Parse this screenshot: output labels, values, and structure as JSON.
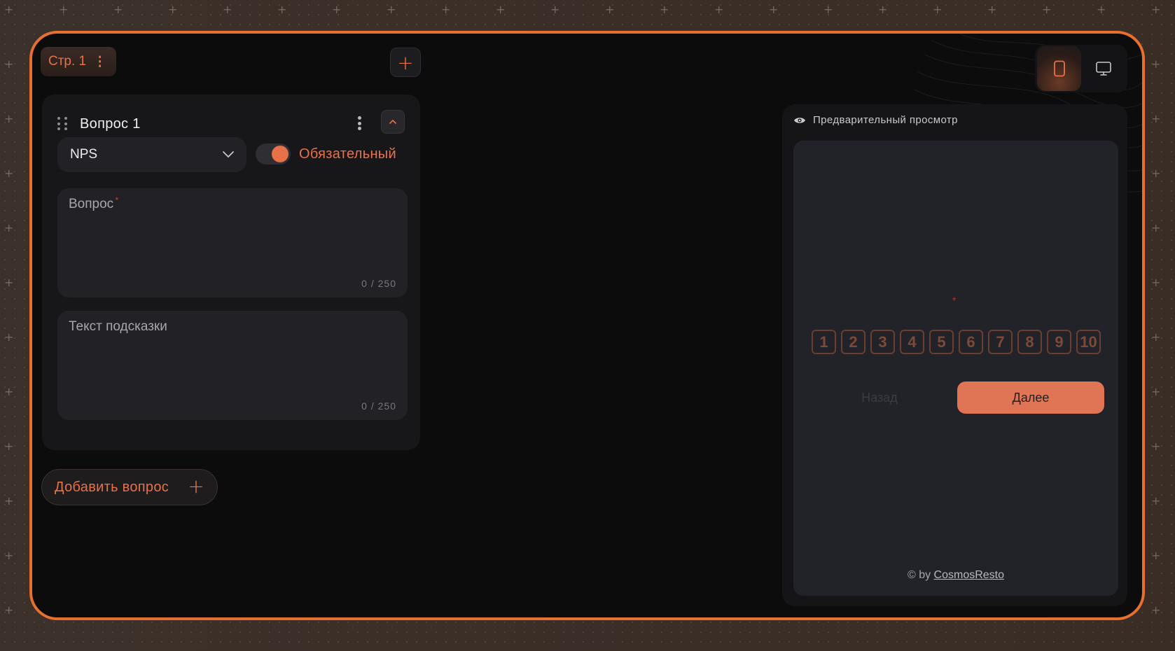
{
  "theme": {
    "accent": "#e8714a",
    "frame_border": "#e8702e",
    "background": "#0c0c0d",
    "required": "#e23a3a"
  },
  "page_tab": {
    "label": "Стр. 1",
    "menu_icon": "kebab-vertical-icon"
  },
  "add_page": {
    "icon": "plus-icon"
  },
  "question": {
    "title": "Вопрос 1",
    "type_value": "NPS",
    "required_label": "Обязательный",
    "required_on": true,
    "question_placeholder": "Вопрос",
    "question_counter": "0 / 250",
    "hint_placeholder": "Текст подсказки",
    "hint_counter": "0 / 250"
  },
  "add_question": {
    "label": "Добавить вопрос"
  },
  "device_switch": {
    "active": "mobile",
    "options": [
      "mobile",
      "desktop"
    ]
  },
  "preview": {
    "title": "Предварительный просмотр",
    "nps_values": [
      "1",
      "2",
      "3",
      "4",
      "5",
      "6",
      "7",
      "8",
      "9",
      "10"
    ],
    "back_label": "Назад",
    "next_label": "Далее",
    "credit_prefix": "© by",
    "credit_link": "CosmosResto"
  }
}
